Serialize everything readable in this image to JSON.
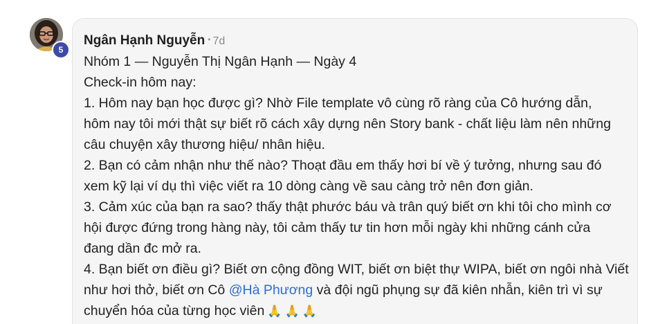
{
  "top_fragment": "· · · · · ·",
  "post": {
    "author": "Ngân Hạnh Nguyễn",
    "time": "7d",
    "level": "5",
    "lines": [
      "Nhóm 1 — Nguyễn Thị Ngân Hạnh — Ngày 4",
      "Check-in hôm nay:",
      "1. Hôm nay bạn học được gì? Nhờ File template vô cùng rõ ràng của Cô hướng dẫn,",
      "hôm nay tôi mới thật sự biết rõ cách xây dựng nên Story bank - chất liệu làm nên những",
      "câu chuyện xây thương hiệu/ nhân hiệu.",
      "2. Bạn có cảm nhận như thế nào? Thoạt đầu em thấy hơi bí về ý tưởng, nhưng sau đó",
      "xem kỹ lại ví dụ thì việc viết ra 10 dòng càng về sau càng trở nên đơn giản.",
      "3. Cảm xúc của bạn ra sao? thấy thật phước báu và trân quý biết ơn khi tôi cho mình cơ",
      "hội được đứng trong hàng này, tôi cảm thấy tư tin hơn mỗi ngày khi những cánh cửa",
      "đang dần đc mở ra.",
      "4. Bạn biết ơn điều gì? Biết ơn cộng đồng WIT, biết ơn biệt thự WIPA, biết ơn ngôi nhà Viết"
    ],
    "line_mention": {
      "before": "như hơi thở, biết ơn Cô ",
      "mention": "@Hà Phương",
      "after": " và đội ngũ phụng sự đã kiên nhẫn, kiên trì vì sự"
    },
    "last_line": "chuyển hóa của từng học viên",
    "emojis": [
      "🙏",
      "🙏",
      "🙏"
    ]
  },
  "colors": {
    "bubble": "#f5f5f5",
    "mention": "#2c6ed8",
    "badge": "#3d4aa8"
  },
  "icons": {
    "emoji": "folded-hands-icon"
  }
}
